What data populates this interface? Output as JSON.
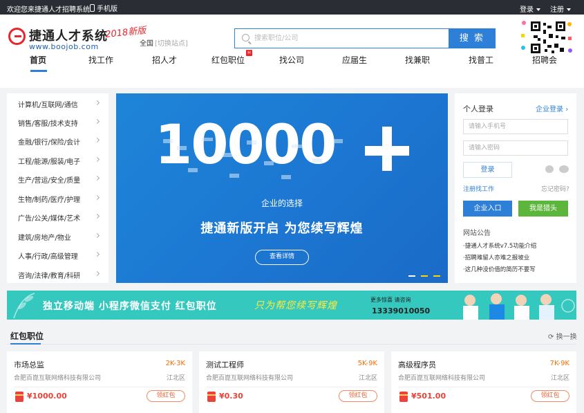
{
  "topbar": {
    "welcome": "欢迎您来捷通人才招聘系统",
    "mobile": "手机版",
    "login": "登录",
    "register": "注册"
  },
  "header": {
    "logo_name": "捷通人才系统",
    "logo_version": "2018新版",
    "logo_url": "www.boojob.com",
    "region": "全国",
    "region_switch": "[切换站点]",
    "search_placeholder": "搜索职位/公司",
    "search_button": "搜 索"
  },
  "nav": [
    {
      "label": "首页",
      "active": true
    },
    {
      "label": "找工作"
    },
    {
      "label": "招人才"
    },
    {
      "label": "红包职位",
      "badge": "H"
    },
    {
      "label": "找公司"
    },
    {
      "label": "应届生"
    },
    {
      "label": "找兼职"
    },
    {
      "label": "找普工"
    },
    {
      "label": "招聘会"
    }
  ],
  "categories": [
    "计算机/互联网/通信",
    "销售/客服/技术支持",
    "金融/银行/保险/会计",
    "工程/能源/服装/电子",
    "生产/营运/安全/质量",
    "生物/制药/医疗/护理",
    "广告/公关/媒体/艺术",
    "建筑/房地产/物业",
    "人事/行政/高级管理",
    "咨询/法律/教育/科研"
  ],
  "banner": {
    "big_number": "10000",
    "tagline": "企业的选择",
    "slogan": "捷通新版开启 为您续写辉煌",
    "button": "查看详情"
  },
  "login_panel": {
    "title": "个人登录",
    "enterprise_link": "企业登录",
    "phone_placeholder": "请输入手机号",
    "password_placeholder": "请输入密码",
    "login_button": "登录",
    "register_link": "注册找工作",
    "forgot_link": "忘记密码?",
    "enterprise_entry": "企业入口",
    "hunter_button": "我是猎头",
    "notice_title": "网站公告",
    "notices": [
      "·捷通人才系统v7.5功能介绍",
      "·招聘难留人亦难之报坡业",
      "·这几种没价值的简历不要写"
    ]
  },
  "ad_banner": {
    "text1": "独立移动端 小程序微信支付 红包职位",
    "text2": "只为帮您续写辉煌",
    "text3": "更多惊喜 请咨询",
    "phone": "13339010050"
  },
  "hongbao_section": {
    "title": "红包职位",
    "refresh": "换一换"
  },
  "jobs": [
    {
      "title": "市场总监",
      "salary": "2K-3K",
      "company": "合肥百崑互联网络科技有限公司",
      "area": "江北区",
      "amount": "¥1000.00",
      "action": "领红包"
    },
    {
      "title": "测试工程师",
      "salary": "5K-9K",
      "company": "合肥百崑互联网络科技有限公司",
      "area": "江北区",
      "amount": "¥0.30",
      "action": "领红包"
    },
    {
      "title": "高级程序员",
      "salary": "7K-9K",
      "company": "合肥百崑互联网络科技有限公司",
      "area": "江北区",
      "amount": "¥501.00",
      "action": "领红包"
    }
  ],
  "colors": {
    "brand_blue": "#2d7fd7",
    "brand_red": "#e8252b",
    "green": "#5cb63c",
    "teal": "#35c8bf"
  }
}
